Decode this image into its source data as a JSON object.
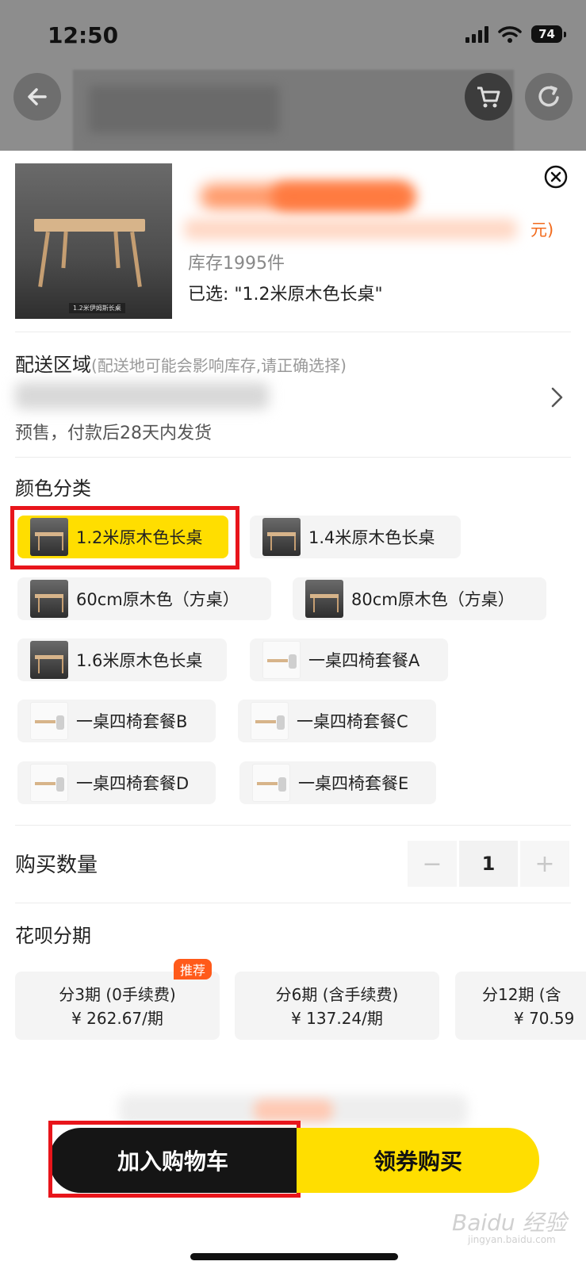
{
  "status_bar": {
    "time": "12:50",
    "battery": "74"
  },
  "product": {
    "image_caption": "1.2米伊姆斯长桌",
    "price_suffix": "元)",
    "stock": "库存1995件",
    "selected": "已选: \"1.2米原木色长桌\""
  },
  "delivery": {
    "title": "配送区域",
    "hint": "(配送地可能会影响库存,请正确选择)",
    "presale": "预售，付款后28天内发货"
  },
  "color": {
    "title": "颜色分类",
    "options": [
      {
        "label": "1.2米原木色长桌",
        "selected": true
      },
      {
        "label": "1.4米原木色长桌",
        "selected": false
      },
      {
        "label": "60cm原木色（方桌）",
        "selected": false
      },
      {
        "label": "80cm原木色（方桌）",
        "selected": false
      },
      {
        "label": "1.6米原木色长桌",
        "selected": false
      },
      {
        "label": "一桌四椅套餐A",
        "selected": false
      },
      {
        "label": "一桌四椅套餐B",
        "selected": false
      },
      {
        "label": "一桌四椅套餐C",
        "selected": false
      },
      {
        "label": "一桌四椅套餐D",
        "selected": false
      },
      {
        "label": "一桌四椅套餐E",
        "selected": false
      }
    ]
  },
  "quantity": {
    "label": "购买数量",
    "value": "1",
    "minus": "−",
    "plus": "+"
  },
  "installment": {
    "title": "花呗分期",
    "badge": "推荐",
    "plans": [
      {
        "line1": "分3期 (0手续费)",
        "line2": "¥ 262.67/期"
      },
      {
        "line1": "分6期 (含手续费)",
        "line2": "¥ 137.24/期"
      },
      {
        "line1": "分12期 (含",
        "line2": "¥ 70.59"
      }
    ]
  },
  "actions": {
    "add_to_cart": "加入购物车",
    "buy_now": "领券购买"
  },
  "watermark": {
    "main": "Baidu 经验",
    "sub": "jingyan.baidu.com"
  },
  "colors": {
    "accent": "#ffde00",
    "highlight_box": "#e8151b",
    "badge": "#ff5a1a"
  }
}
